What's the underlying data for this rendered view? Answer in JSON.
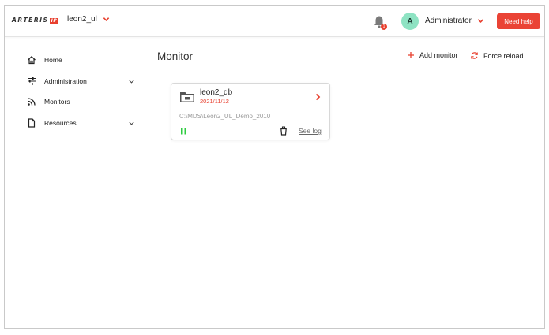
{
  "app": {
    "logo_text": "ARTERIS",
    "logo_suffix": "IP",
    "project_name": "leon2_ul"
  },
  "header": {
    "notification_count": "1",
    "avatar_initial": "A",
    "user_name": "Administrator",
    "help_label": "Need help"
  },
  "sidebar": {
    "items": [
      {
        "label": "Home",
        "icon": "home-icon"
      },
      {
        "label": "Administration",
        "icon": "sliders-icon"
      },
      {
        "label": "Monitors",
        "icon": "rss-icon"
      },
      {
        "label": "Resources",
        "icon": "file-icon"
      }
    ]
  },
  "main": {
    "title": "Monitor",
    "add_label": "Add monitor",
    "reload_label": "Force reload"
  },
  "monitor_card": {
    "name": "leon2_db",
    "date": "2021/11/12",
    "path": "C:\\MDS\\Leon2_UL_Demo_2010",
    "see_log_label": "See log",
    "status": "running"
  },
  "colors": {
    "accent": "#e8402f",
    "status_green": "#2ecc40",
    "avatar_bg": "#8ee3c3"
  }
}
